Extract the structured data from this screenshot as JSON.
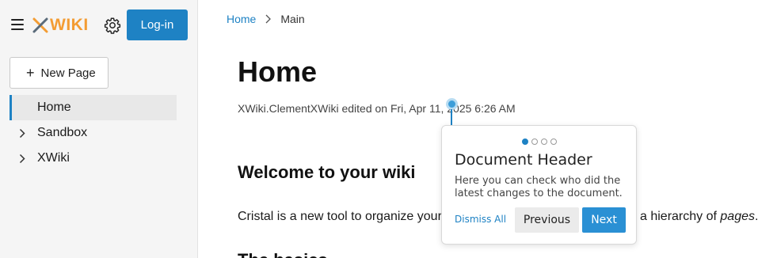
{
  "header": {
    "logo_text": "WIKI",
    "login_label": "Log-in"
  },
  "sidebar": {
    "new_page_label": "New Page",
    "items": [
      {
        "label": "Home"
      },
      {
        "label": "Sandbox"
      },
      {
        "label": "XWiki"
      }
    ]
  },
  "breadcrumb": {
    "home": "Home",
    "current": "Main"
  },
  "page": {
    "title": "Home",
    "meta": "XWiki.ClementXWiki edited on Fri, Apr 11, 2025 6:26 AM",
    "heading": "Welcome to your wiki",
    "para_left": "Cristal is a new tool to organize your",
    "para_right_prefix": "a hierarchy of ",
    "para_right_em": "pages",
    "para_right_suffix": ".",
    "next_heading_partial": "The basics"
  },
  "tour": {
    "step": 1,
    "total_steps": 4,
    "title": "Document Header",
    "body": "Here you can check who did the latest changes to the document.",
    "dismiss_label": "Dismiss All",
    "previous_label": "Previous",
    "next_label": "Next"
  },
  "colors": {
    "accent": "#1e82c4",
    "logo": "#f39c33"
  }
}
